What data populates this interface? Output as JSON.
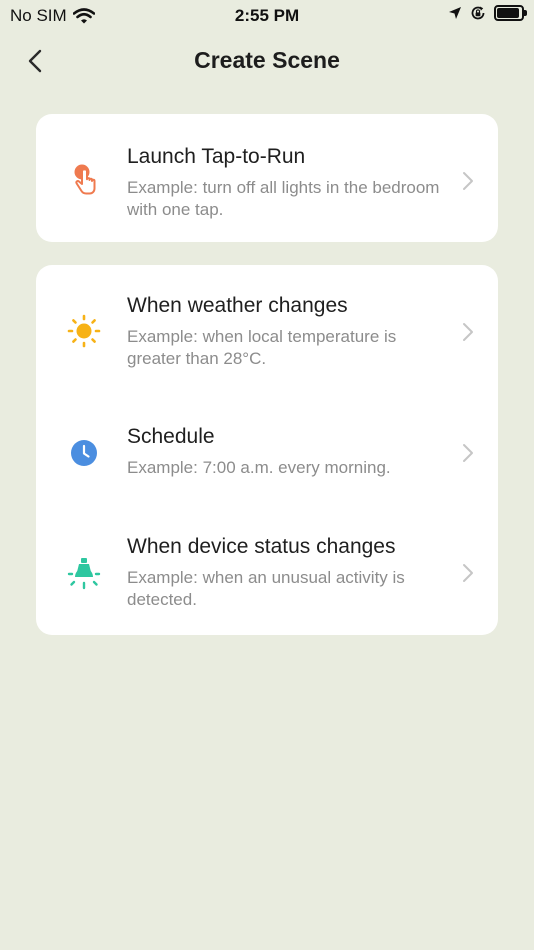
{
  "status_bar": {
    "carrier": "No SIM",
    "time": "2:55 PM"
  },
  "nav": {
    "title": "Create Scene"
  },
  "options": {
    "tap_to_run": {
      "title": "Launch Tap-to-Run",
      "description": "Example: turn off all lights in the bedroom with one tap.",
      "icon": "tap-hand-icon",
      "color": "#ef7a4f"
    },
    "weather": {
      "title": "When weather changes",
      "description": "Example: when local temperature is greater than 28°C.",
      "icon": "sun-icon",
      "color": "#f7b216"
    },
    "schedule": {
      "title": "Schedule",
      "description": "Example: 7:00 a.m. every morning.",
      "icon": "clock-icon",
      "color": "#4b8ee0"
    },
    "device_status": {
      "title": "When device status changes",
      "description": "Example: when an unusual activity is detected.",
      "icon": "bulb-icon",
      "color": "#2ec7a0"
    }
  },
  "colors": {
    "background": "#e9ecdf",
    "card": "#ffffff",
    "secondary_text": "#8c8c8c"
  }
}
